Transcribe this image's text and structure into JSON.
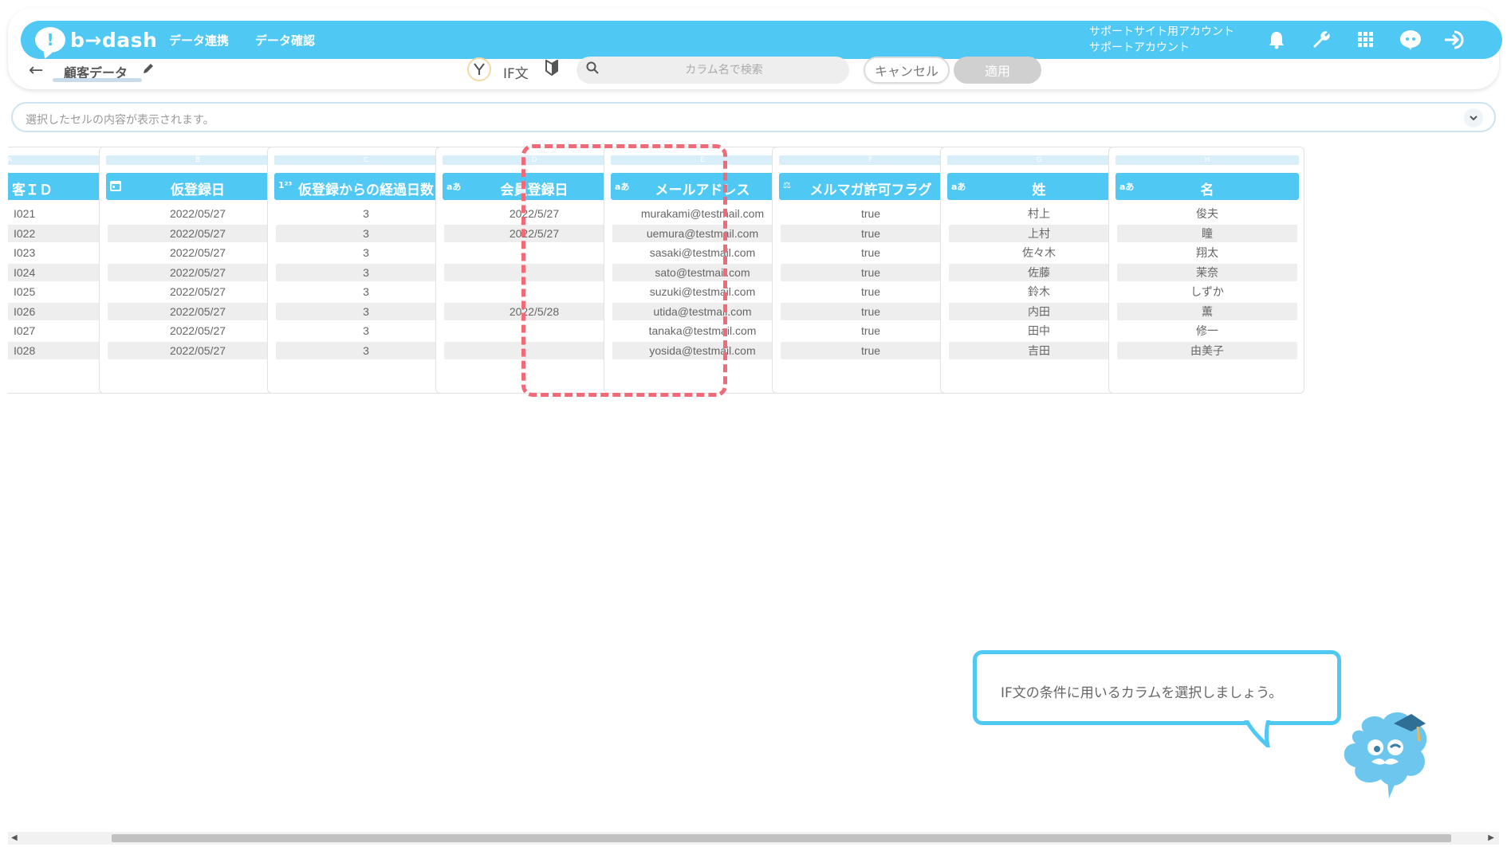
{
  "header": {
    "logo_mark": "!",
    "logo_text": "b→dash",
    "nav": [
      "データ連携",
      "データ確認"
    ],
    "account_line1": "サポートサイト用アカウント",
    "account_line2": "サポートアカウント",
    "icons": [
      "bell-icon",
      "wrench-icon",
      "apps-grid-icon",
      "chat-bot-icon",
      "logout-icon"
    ]
  },
  "toolbar": {
    "back": "←",
    "table_name": "顧客データ",
    "mode_label": "IF文",
    "search_placeholder": "カラム名で検索",
    "cancel_label": "キャンセル",
    "apply_label": "適用"
  },
  "cell_viewer": {
    "placeholder": "選択したセルの内容が表示されます。"
  },
  "columns": [
    {
      "letter": "A",
      "type": "",
      "title": "客ＩＤ",
      "cells": [
        "I021",
        "I022",
        "I023",
        "I024",
        "I025",
        "I026",
        "I027",
        "I028"
      ]
    },
    {
      "letter": "B",
      "type": "calendar",
      "title": "仮登録日",
      "cells": [
        "2022/05/27",
        "2022/05/27",
        "2022/05/27",
        "2022/05/27",
        "2022/05/27",
        "2022/05/27",
        "2022/05/27",
        "2022/05/27"
      ]
    },
    {
      "letter": "C",
      "type": "1²³",
      "title": "仮登録からの経過日数",
      "cells": [
        "3",
        "3",
        "3",
        "3",
        "3",
        "3",
        "3",
        "3"
      ]
    },
    {
      "letter": "D",
      "type": "aあ",
      "title": "会員登録日",
      "cells": [
        "2022/5/27",
        "2022/5/27",
        "",
        "",
        "",
        "2022/5/28",
        "",
        ""
      ]
    },
    {
      "letter": "E",
      "type": "aあ",
      "title": "メールアドレス",
      "cells": [
        "murakami@testmail.com",
        "uemura@testmail.com",
        "sasaki@testmail.com",
        "sato@testmail.com",
        "suzuki@testmail.com",
        "utida@testmail.com",
        "tanaka@testmail.com",
        "yosida@testmail.com"
      ]
    },
    {
      "letter": "F",
      "type": "⚖",
      "title": "メルマガ許可フラグ",
      "cells": [
        "true",
        "true",
        "true",
        "true",
        "true",
        "true",
        "true",
        "true"
      ]
    },
    {
      "letter": "G",
      "type": "aあ",
      "title": "姓",
      "cells": [
        "村上",
        "上村",
        "佐々木",
        "佐藤",
        "鈴木",
        "内田",
        "田中",
        "吉田"
      ]
    },
    {
      "letter": "H",
      "type": "aあ",
      "title": "名",
      "cells": [
        "俊夫",
        "瞳",
        "翔太",
        "茉奈",
        "しずか",
        "薫",
        "修一",
        "由美子"
      ]
    }
  ],
  "tooltip": {
    "text": "IF文の条件に用いるカラムを選択しましょう。"
  },
  "colors": {
    "brand": "#4fc9f3",
    "highlight": "#f06a78"
  }
}
